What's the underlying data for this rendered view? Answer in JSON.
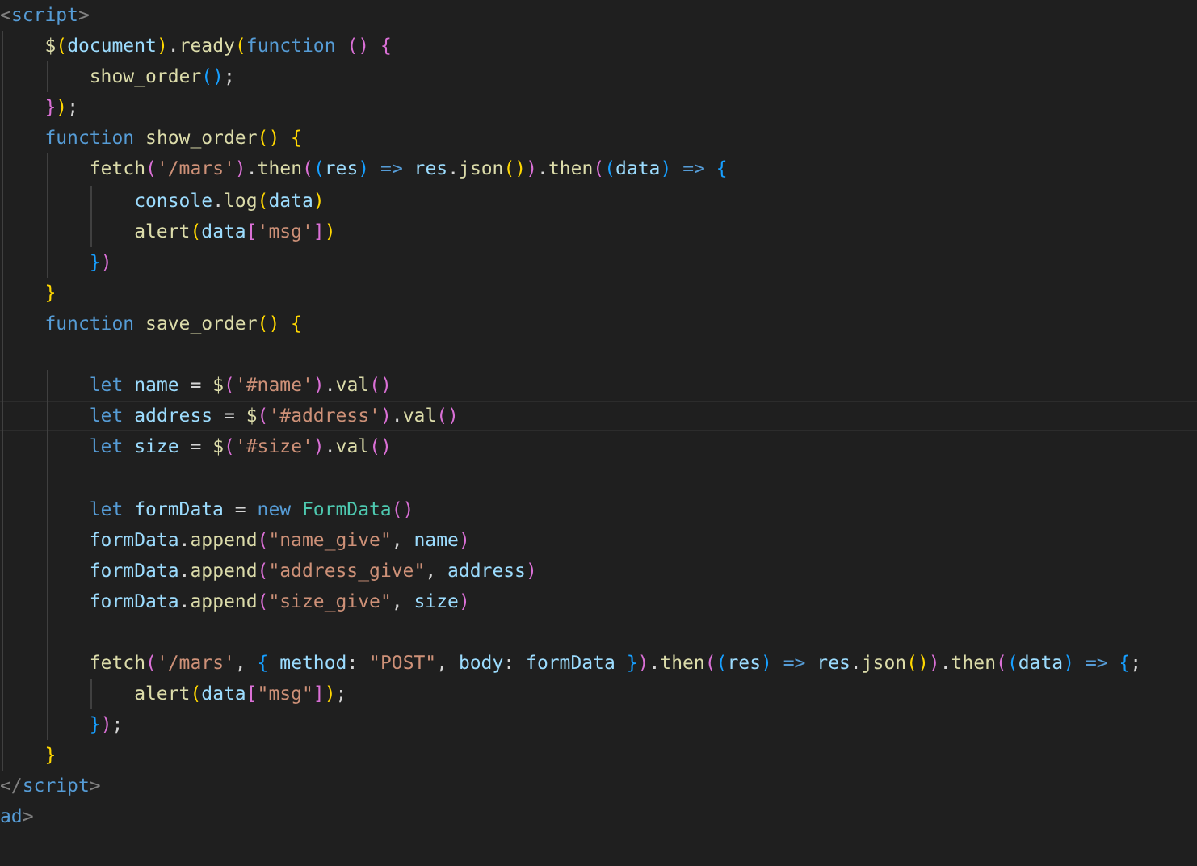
{
  "editor": {
    "lines": [
      {
        "current": false,
        "tokens": [
          {
            "text": "<",
            "kind": "tag"
          },
          {
            "text": "script",
            "kind": "tagname"
          },
          {
            "text": ">",
            "kind": "tag"
          }
        ]
      },
      {
        "current": false,
        "tokens": [
          {
            "text": "    $",
            "kind": "fn"
          },
          {
            "text": "(",
            "kind": "b1"
          },
          {
            "text": "document",
            "kind": "var"
          },
          {
            "text": ")",
            "kind": "b1"
          },
          {
            "text": ".",
            "kind": "plain"
          },
          {
            "text": "ready",
            "kind": "fn"
          },
          {
            "text": "(",
            "kind": "b1"
          },
          {
            "text": "function",
            "kind": "kw"
          },
          {
            "text": " ()",
            "kind": "b2"
          },
          {
            "text": " {",
            "kind": "b2"
          }
        ]
      },
      {
        "current": false,
        "tokens": [
          {
            "text": "        show_order",
            "kind": "fn"
          },
          {
            "text": "()",
            "kind": "b3"
          },
          {
            "text": ";",
            "kind": "plain"
          }
        ]
      },
      {
        "current": false,
        "tokens": [
          {
            "text": "    }",
            "kind": "b2"
          },
          {
            "text": ")",
            "kind": "b1"
          },
          {
            "text": ";",
            "kind": "plain"
          }
        ]
      },
      {
        "current": false,
        "tokens": [
          {
            "text": "    function",
            "kind": "kw"
          },
          {
            "text": " show_order",
            "kind": "fn"
          },
          {
            "text": "()",
            "kind": "b1"
          },
          {
            "text": " {",
            "kind": "b1"
          }
        ]
      },
      {
        "current": false,
        "tokens": [
          {
            "text": "        fetch",
            "kind": "fn"
          },
          {
            "text": "(",
            "kind": "b2"
          },
          {
            "text": "'/mars'",
            "kind": "str"
          },
          {
            "text": ")",
            "kind": "b2"
          },
          {
            "text": ".",
            "kind": "plain"
          },
          {
            "text": "then",
            "kind": "fn"
          },
          {
            "text": "(",
            "kind": "b2"
          },
          {
            "text": "(",
            "kind": "b3"
          },
          {
            "text": "res",
            "kind": "var"
          },
          {
            "text": ")",
            "kind": "b3"
          },
          {
            "text": " => ",
            "kind": "kw"
          },
          {
            "text": "res",
            "kind": "var"
          },
          {
            "text": ".",
            "kind": "plain"
          },
          {
            "text": "json",
            "kind": "fn"
          },
          {
            "text": "()",
            "kind": "b1"
          },
          {
            "text": ")",
            "kind": "b2"
          },
          {
            "text": ".",
            "kind": "plain"
          },
          {
            "text": "then",
            "kind": "fn"
          },
          {
            "text": "(",
            "kind": "b2"
          },
          {
            "text": "(",
            "kind": "b3"
          },
          {
            "text": "data",
            "kind": "var"
          },
          {
            "text": ")",
            "kind": "b3"
          },
          {
            "text": " => ",
            "kind": "kw"
          },
          {
            "text": "{",
            "kind": "b3"
          }
        ]
      },
      {
        "current": false,
        "tokens": [
          {
            "text": "            console",
            "kind": "var"
          },
          {
            "text": ".",
            "kind": "plain"
          },
          {
            "text": "log",
            "kind": "fn"
          },
          {
            "text": "(",
            "kind": "b1"
          },
          {
            "text": "data",
            "kind": "var"
          },
          {
            "text": ")",
            "kind": "b1"
          }
        ]
      },
      {
        "current": false,
        "tokens": [
          {
            "text": "            alert",
            "kind": "fn"
          },
          {
            "text": "(",
            "kind": "b1"
          },
          {
            "text": "data",
            "kind": "var"
          },
          {
            "text": "[",
            "kind": "b2"
          },
          {
            "text": "'msg'",
            "kind": "str"
          },
          {
            "text": "]",
            "kind": "b2"
          },
          {
            "text": ")",
            "kind": "b1"
          }
        ]
      },
      {
        "current": false,
        "tokens": [
          {
            "text": "        }",
            "kind": "b3"
          },
          {
            "text": ")",
            "kind": "b2"
          }
        ]
      },
      {
        "current": false,
        "tokens": [
          {
            "text": "    }",
            "kind": "b1"
          }
        ]
      },
      {
        "current": false,
        "tokens": [
          {
            "text": "    function",
            "kind": "kw"
          },
          {
            "text": " save_order",
            "kind": "fn"
          },
          {
            "text": "()",
            "kind": "b1"
          },
          {
            "text": " {",
            "kind": "b1"
          }
        ]
      },
      {
        "current": false
      },
      {
        "current": false,
        "tokens": [
          {
            "text": "        let",
            "kind": "kw"
          },
          {
            "text": " name",
            "kind": "var"
          },
          {
            "text": " = ",
            "kind": "plain"
          },
          {
            "text": "$",
            "kind": "fn"
          },
          {
            "text": "(",
            "kind": "b2"
          },
          {
            "text": "'#name'",
            "kind": "str"
          },
          {
            "text": ")",
            "kind": "b2"
          },
          {
            "text": ".",
            "kind": "plain"
          },
          {
            "text": "val",
            "kind": "fn"
          },
          {
            "text": "()",
            "kind": "b2"
          }
        ]
      },
      {
        "current": true,
        "tokens": [
          {
            "text": "        let",
            "kind": "kw"
          },
          {
            "text": " address",
            "kind": "var"
          },
          {
            "text": " = ",
            "kind": "plain"
          },
          {
            "text": "$",
            "kind": "fn"
          },
          {
            "text": "(",
            "kind": "b2"
          },
          {
            "text": "'#address'",
            "kind": "str"
          },
          {
            "text": ")",
            "kind": "b2"
          },
          {
            "text": ".",
            "kind": "plain"
          },
          {
            "text": "val",
            "kind": "fn"
          },
          {
            "text": "()",
            "kind": "b2"
          }
        ]
      },
      {
        "current": false,
        "tokens": [
          {
            "text": "        let",
            "kind": "kw"
          },
          {
            "text": " size",
            "kind": "var"
          },
          {
            "text": " = ",
            "kind": "plain"
          },
          {
            "text": "$",
            "kind": "fn"
          },
          {
            "text": "(",
            "kind": "b2"
          },
          {
            "text": "'#size'",
            "kind": "str"
          },
          {
            "text": ")",
            "kind": "b2"
          },
          {
            "text": ".",
            "kind": "plain"
          },
          {
            "text": "val",
            "kind": "fn"
          },
          {
            "text": "()",
            "kind": "b2"
          }
        ]
      },
      {
        "current": false
      },
      {
        "current": false,
        "tokens": [
          {
            "text": "        let",
            "kind": "kw"
          },
          {
            "text": " formData",
            "kind": "var"
          },
          {
            "text": " = ",
            "kind": "plain"
          },
          {
            "text": "new",
            "kind": "kw"
          },
          {
            "text": " FormData",
            "kind": "cls"
          },
          {
            "text": "()",
            "kind": "b2"
          }
        ]
      },
      {
        "current": false,
        "tokens": [
          {
            "text": "        formData",
            "kind": "var"
          },
          {
            "text": ".",
            "kind": "plain"
          },
          {
            "text": "append",
            "kind": "fn"
          },
          {
            "text": "(",
            "kind": "b2"
          },
          {
            "text": "\"name_give\"",
            "kind": "str"
          },
          {
            "text": ", ",
            "kind": "plain"
          },
          {
            "text": "name",
            "kind": "var"
          },
          {
            "text": ")",
            "kind": "b2"
          }
        ]
      },
      {
        "current": false,
        "tokens": [
          {
            "text": "        formData",
            "kind": "var"
          },
          {
            "text": ".",
            "kind": "plain"
          },
          {
            "text": "append",
            "kind": "fn"
          },
          {
            "text": "(",
            "kind": "b2"
          },
          {
            "text": "\"address_give\"",
            "kind": "str"
          },
          {
            "text": ", ",
            "kind": "plain"
          },
          {
            "text": "address",
            "kind": "var"
          },
          {
            "text": ")",
            "kind": "b2"
          }
        ]
      },
      {
        "current": false,
        "tokens": [
          {
            "text": "        formData",
            "kind": "var"
          },
          {
            "text": ".",
            "kind": "plain"
          },
          {
            "text": "append",
            "kind": "fn"
          },
          {
            "text": "(",
            "kind": "b2"
          },
          {
            "text": "\"size_give\"",
            "kind": "str"
          },
          {
            "text": ", ",
            "kind": "plain"
          },
          {
            "text": "size",
            "kind": "var"
          },
          {
            "text": ")",
            "kind": "b2"
          }
        ]
      },
      {
        "current": false
      },
      {
        "current": false,
        "tokens": [
          {
            "text": "        fetch",
            "kind": "fn"
          },
          {
            "text": "(",
            "kind": "b2"
          },
          {
            "text": "'/mars'",
            "kind": "str"
          },
          {
            "text": ", ",
            "kind": "plain"
          },
          {
            "text": "{",
            "kind": "b3"
          },
          {
            "text": " method",
            "kind": "var"
          },
          {
            "text": ": ",
            "kind": "plain"
          },
          {
            "text": "\"POST\"",
            "kind": "str"
          },
          {
            "text": ", ",
            "kind": "plain"
          },
          {
            "text": "body",
            "kind": "var"
          },
          {
            "text": ": ",
            "kind": "plain"
          },
          {
            "text": "formData",
            "kind": "var"
          },
          {
            "text": " }",
            "kind": "b3"
          },
          {
            "text": ")",
            "kind": "b2"
          },
          {
            "text": ".",
            "kind": "plain"
          },
          {
            "text": "then",
            "kind": "fn"
          },
          {
            "text": "(",
            "kind": "b2"
          },
          {
            "text": "(",
            "kind": "b3"
          },
          {
            "text": "res",
            "kind": "var"
          },
          {
            "text": ")",
            "kind": "b3"
          },
          {
            "text": " => ",
            "kind": "kw"
          },
          {
            "text": "res",
            "kind": "var"
          },
          {
            "text": ".",
            "kind": "plain"
          },
          {
            "text": "json",
            "kind": "fn"
          },
          {
            "text": "()",
            "kind": "b1"
          },
          {
            "text": ")",
            "kind": "b2"
          },
          {
            "text": ".",
            "kind": "plain"
          },
          {
            "text": "then",
            "kind": "fn"
          },
          {
            "text": "(",
            "kind": "b2"
          },
          {
            "text": "(",
            "kind": "b3"
          },
          {
            "text": "data",
            "kind": "var"
          },
          {
            "text": ")",
            "kind": "b3"
          },
          {
            "text": " => ",
            "kind": "kw"
          },
          {
            "text": "{",
            "kind": "b3"
          },
          {
            "text": ";",
            "kind": "plain"
          }
        ]
      },
      {
        "current": false,
        "tokens": [
          {
            "text": "            alert",
            "kind": "fn"
          },
          {
            "text": "(",
            "kind": "b1"
          },
          {
            "text": "data",
            "kind": "var"
          },
          {
            "text": "[",
            "kind": "b2"
          },
          {
            "text": "\"msg\"",
            "kind": "str"
          },
          {
            "text": "]",
            "kind": "b2"
          },
          {
            "text": ")",
            "kind": "b1"
          },
          {
            "text": ";",
            "kind": "plain"
          }
        ]
      },
      {
        "current": false,
        "tokens": [
          {
            "text": "        }",
            "kind": "b3"
          },
          {
            "text": ")",
            "kind": "b2"
          },
          {
            "text": ";",
            "kind": "plain"
          }
        ]
      },
      {
        "current": false,
        "tokens": [
          {
            "text": "    }",
            "kind": "b1"
          }
        ]
      },
      {
        "current": false,
        "tokens": [
          {
            "text": "</",
            "kind": "tag"
          },
          {
            "text": "script",
            "kind": "tagname"
          },
          {
            "text": ">",
            "kind": "tag"
          }
        ]
      },
      {
        "current": false,
        "tokens": [
          {
            "text": "ad",
            "kind": "tagname"
          },
          {
            "text": ">",
            "kind": "tag"
          }
        ]
      }
    ]
  }
}
